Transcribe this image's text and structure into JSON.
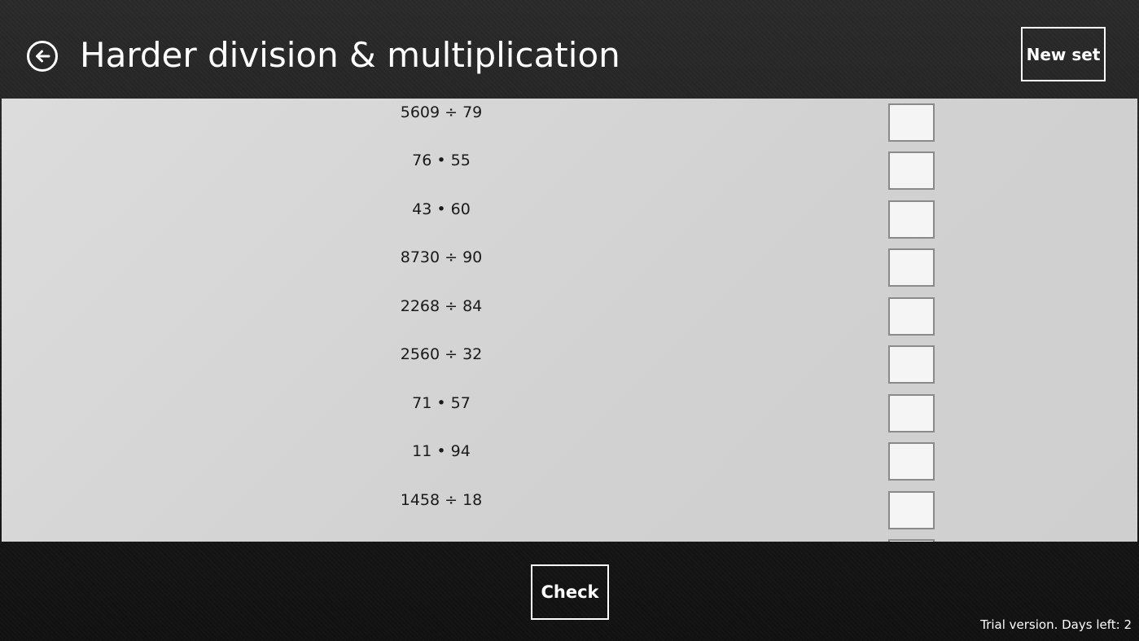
{
  "header": {
    "title": "Harder division & multiplication",
    "back_icon": "arrow-left-circle-icon",
    "new_set_label": "New set"
  },
  "problems": [
    {
      "expression": "5609 ÷ 79",
      "answer": ""
    },
    {
      "expression": "76 • 55",
      "answer": ""
    },
    {
      "expression": "43 • 60",
      "answer": ""
    },
    {
      "expression": "8730 ÷ 90",
      "answer": ""
    },
    {
      "expression": "2268 ÷ 84",
      "answer": ""
    },
    {
      "expression": "2560 ÷ 32",
      "answer": ""
    },
    {
      "expression": "71 • 57",
      "answer": ""
    },
    {
      "expression": "11 • 94",
      "answer": ""
    },
    {
      "expression": "1458 ÷ 18",
      "answer": ""
    },
    {
      "expression": "",
      "answer": ""
    }
  ],
  "footer": {
    "check_label": "Check",
    "trial_status": "Trial version. Days left: 2"
  },
  "colors": {
    "panel_background": "#d4d4d4",
    "chrome_background": "#151515",
    "text_light": "#ffffff",
    "text_dark": "#1a1a1a"
  }
}
